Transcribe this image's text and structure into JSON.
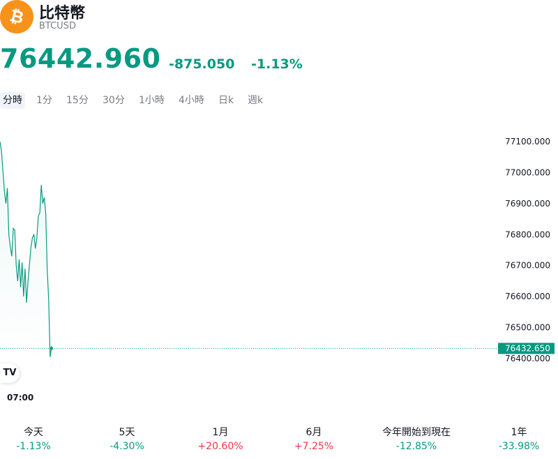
{
  "symbol": {
    "name": "比特幣",
    "ticker": "BTCUSD",
    "logo_icon": "bitcoin-icon",
    "price": "76442.960",
    "change": "-875.050",
    "change_percent": "-1.13%"
  },
  "intervals": [
    {
      "label": "分時",
      "active": true
    },
    {
      "label": "1分",
      "active": false
    },
    {
      "label": "15分",
      "active": false
    },
    {
      "label": "30分",
      "active": false
    },
    {
      "label": "1小時",
      "active": false
    },
    {
      "label": "4小時",
      "active": false
    },
    {
      "label": "日k",
      "active": false
    },
    {
      "label": "週k",
      "active": false
    }
  ],
  "chart_data": {
    "type": "area",
    "y_ticks": [
      "77100.000",
      "77000.000",
      "76900.000",
      "76800.000",
      "76700.000",
      "76600.000",
      "76500.000",
      "76400.000"
    ],
    "y_tick_values": [
      77100,
      77000,
      76900,
      76800,
      76700,
      76600,
      76500,
      76400
    ],
    "ylim": [
      76370,
      77140
    ],
    "x_ticks": [
      "07:00"
    ],
    "last_price_label": "76432.650",
    "last_price": 76432.65,
    "series": [
      {
        "values": [
          77100,
          77070,
          77005,
          76940,
          76900,
          76950,
          76800,
          76760,
          76730,
          76820,
          76815,
          76700,
          76650,
          76720,
          76630,
          76710,
          76600,
          76690,
          76580,
          76650,
          76705,
          76760,
          76790,
          76800,
          76755,
          76790,
          76860,
          76870,
          76960,
          76900,
          76920,
          76870,
          76690,
          76590,
          76405,
          76440
        ]
      }
    ],
    "colors": {
      "line": "#089981",
      "area": "#089981",
      "up": "#f23645",
      "down": "#089981"
    }
  },
  "tv_logo_text": "TV",
  "periods": [
    {
      "label": "今天",
      "value": "-1.13%",
      "direction": "down"
    },
    {
      "label": "5天",
      "value": "-4.30%",
      "direction": "down"
    },
    {
      "label": "1月",
      "value": "+20.60%",
      "direction": "up"
    },
    {
      "label": "6月",
      "value": "+7.25%",
      "direction": "up"
    },
    {
      "label": "今年開始到現在",
      "value": "-12.85%",
      "direction": "down"
    },
    {
      "label": "1年",
      "value": "-33.98%",
      "direction": "down"
    }
  ]
}
